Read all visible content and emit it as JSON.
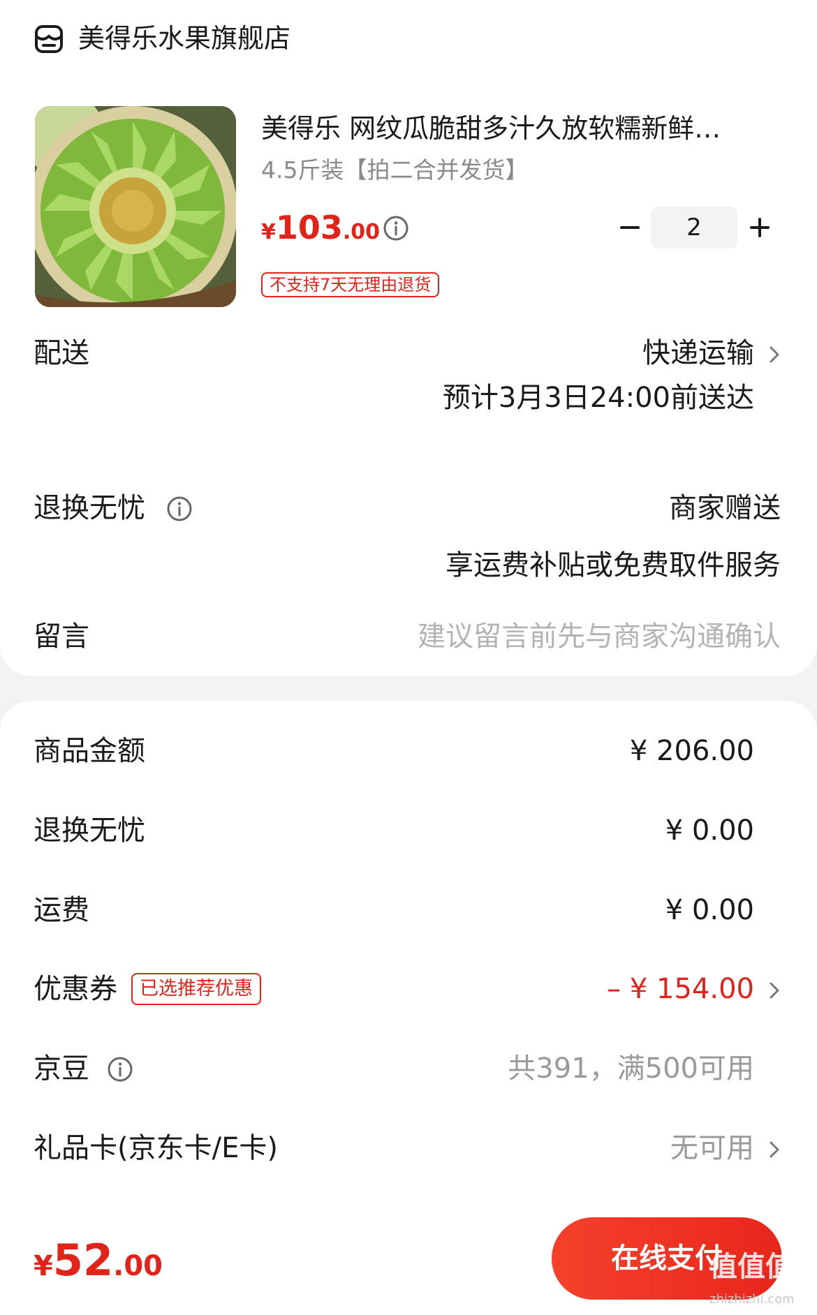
{
  "store": {
    "name": "美得乐水果旗舰店",
    "icon": "store-icon"
  },
  "product": {
    "title": "美得乐 网纹瓜脆甜多汁久放软糯新鲜…",
    "spec": "4.5斤装【拍二合并发货】",
    "price_symbol": "¥",
    "price_int": "103",
    "price_dec": ".00",
    "quantity": "2",
    "minus_label": "−",
    "plus_label": "+",
    "no_return_tag": "不支持7天无理由退货",
    "image_icon": "melon-image"
  },
  "delivery": {
    "label": "配送",
    "method": "快递运输",
    "eta": "预计3月3日24:00前送达"
  },
  "worry_free": {
    "label": "退换无忧",
    "value": "商家赠送",
    "desc": "享运费补贴或免费取件服务"
  },
  "message": {
    "label": "留言",
    "placeholder": "建议留言前先与商家沟通确认"
  },
  "summary": {
    "goods_label": "商品金额",
    "goods_value": "¥ 206.00",
    "worry_label": "退换无忧",
    "worry_value": "¥ 0.00",
    "shipping_label": "运费",
    "shipping_value": "¥ 0.00",
    "coupon_label": "优惠券",
    "coupon_tag": "已选推荐优惠",
    "coupon_value": "– ¥ 154.00",
    "jingdou_label": "京豆",
    "jingdou_value": "共391，满500可用",
    "giftcard_label": "礼品卡(京东卡/E卡)",
    "giftcard_value": "无可用"
  },
  "footer": {
    "total_symbol": "¥",
    "total_int": "52",
    "total_dec": ".00",
    "pay_label": "在线支付",
    "watermark": "值值值",
    "watermark_sub": "zhizhizhi.com"
  },
  "colors": {
    "accent": "#e2231a",
    "grey_text": "#9a9a9a",
    "background": "#f3f3f3"
  }
}
